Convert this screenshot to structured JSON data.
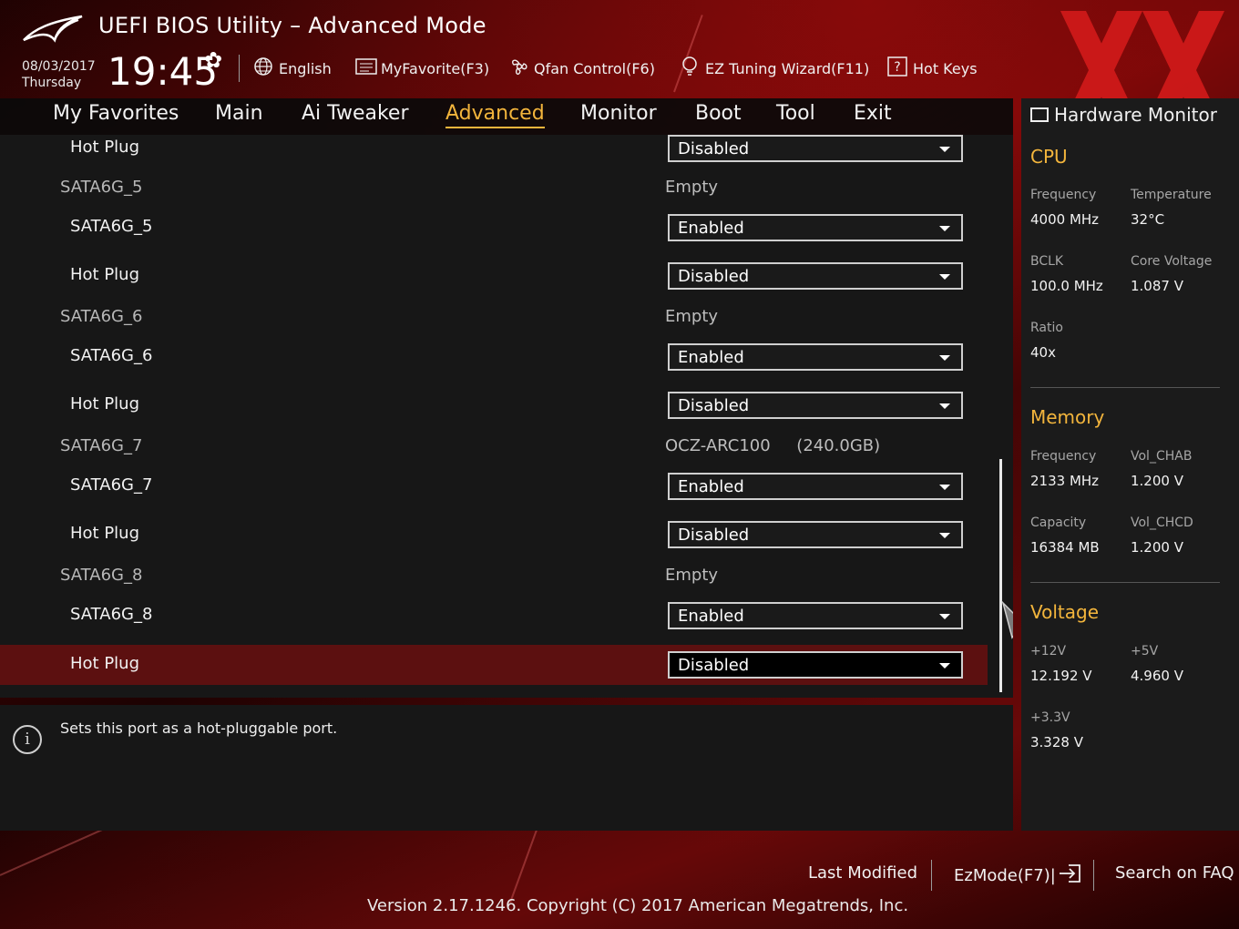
{
  "header": {
    "title": "UEFI BIOS Utility – Advanced Mode",
    "date": "08/03/2017",
    "day": "Thursday",
    "time": "19:45",
    "toolbar": {
      "language": "English",
      "my_favorite": "MyFavorite(F3)",
      "qfan": "Qfan Control(F6)",
      "ez_tuning": "EZ Tuning Wizard(F11)",
      "hot_keys": "Hot Keys"
    }
  },
  "tabs": [
    "My Favorites",
    "Main",
    "Ai Tweaker",
    "Advanced",
    "Monitor",
    "Boot",
    "Tool",
    "Exit"
  ],
  "active_tab": "Advanced",
  "settings": [
    {
      "label": "Hot Plug",
      "value": "Disabled",
      "type": "dropdown"
    },
    {
      "label": "SATA6G_5",
      "value": "Empty",
      "type": "info"
    },
    {
      "label": "SATA6G_5",
      "value": "Enabled",
      "type": "dropdown"
    },
    {
      "label": "Hot Plug",
      "value": "Disabled",
      "type": "dropdown"
    },
    {
      "label": "SATA6G_6",
      "value": "Empty",
      "type": "info"
    },
    {
      "label": "SATA6G_6",
      "value": "Enabled",
      "type": "dropdown"
    },
    {
      "label": "Hot Plug",
      "value": "Disabled",
      "type": "dropdown"
    },
    {
      "label": "SATA6G_7",
      "value": "OCZ-ARC100     (240.0GB)",
      "type": "info"
    },
    {
      "label": "SATA6G_7",
      "value": "Enabled",
      "type": "dropdown"
    },
    {
      "label": "Hot Plug",
      "value": "Disabled",
      "type": "dropdown"
    },
    {
      "label": "SATA6G_8",
      "value": "Empty",
      "type": "info"
    },
    {
      "label": "SATA6G_8",
      "value": "Enabled",
      "type": "dropdown"
    },
    {
      "label": "Hot Plug",
      "value": "Disabled",
      "type": "dropdown",
      "selected": true
    }
  ],
  "help": {
    "text": "Sets this port as a hot-pluggable port."
  },
  "hardware_monitor": {
    "title": "Hardware Monitor",
    "cpu": {
      "heading": "CPU",
      "frequency_label": "Frequency",
      "frequency": "4000 MHz",
      "temperature_label": "Temperature",
      "temperature": "32°C",
      "bclk_label": "BCLK",
      "bclk": "100.0 MHz",
      "core_voltage_label": "Core Voltage",
      "core_voltage": "1.087 V",
      "ratio_label": "Ratio",
      "ratio": "40x"
    },
    "memory": {
      "heading": "Memory",
      "frequency_label": "Frequency",
      "frequency": "2133 MHz",
      "vol_chab_label": "Vol_CHAB",
      "vol_chab": "1.200 V",
      "capacity_label": "Capacity",
      "capacity": "16384 MB",
      "vol_chcd_label": "Vol_CHCD",
      "vol_chcd": "1.200 V"
    },
    "voltage": {
      "heading": "Voltage",
      "v12_label": "+12V",
      "v12": "12.192 V",
      "v5_label": "+5V",
      "v5": "4.960 V",
      "v33_label": "+3.3V",
      "v33": "3.328 V"
    }
  },
  "footer": {
    "last_modified": "Last Modified",
    "ezmode": "EzMode(F7)|",
    "search_faq": "Search on FAQ",
    "version": "Version 2.17.1246. Copyright (C) 2017 American Megatrends, Inc."
  },
  "colors": {
    "accent": "#f3b53c",
    "selected_row": "#5c1010",
    "panel": "#171717"
  }
}
